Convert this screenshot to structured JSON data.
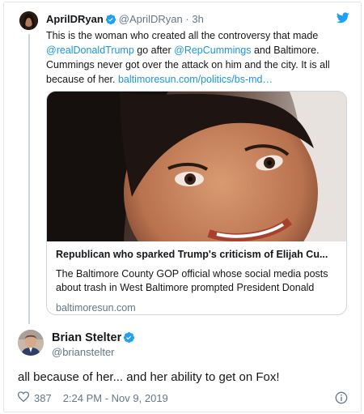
{
  "parent_tweet": {
    "author_name": "AprilDRyan",
    "handle": "@AprilDRyan",
    "separator": "·",
    "time": "3h",
    "text_segments": [
      "This is the woman who created all the controversy that made ",
      "@realDonaldTrump",
      "  go after ",
      "@RepCummings",
      " and Baltimore. Cummings never got over the attack on him and the city.  It is all because of her. ",
      "baltimoresun.com/politics/bs-md…"
    ],
    "card": {
      "title": "Republican who sparked Trump's criticism of Elijah Cu...",
      "description": "The Baltimore County GOP official whose social media posts about trash in West Baltimore prompted President Donald",
      "domain": "baltimoresun.com"
    }
  },
  "main_tweet": {
    "author_name": "Brian Stelter",
    "handle": "@brianstelter",
    "text": "all because of her... and her ability to get on Fox!",
    "likes": "387",
    "timestamp": "2:24 PM - Nov 9, 2019"
  },
  "colors": {
    "link": "#1b95e0",
    "verified": "#1da1f2",
    "muted": "#657786",
    "border": "#e1e8ed"
  },
  "icons": [
    "verified-badge-icon",
    "twitter-bird-icon",
    "heart-icon",
    "info-icon"
  ]
}
